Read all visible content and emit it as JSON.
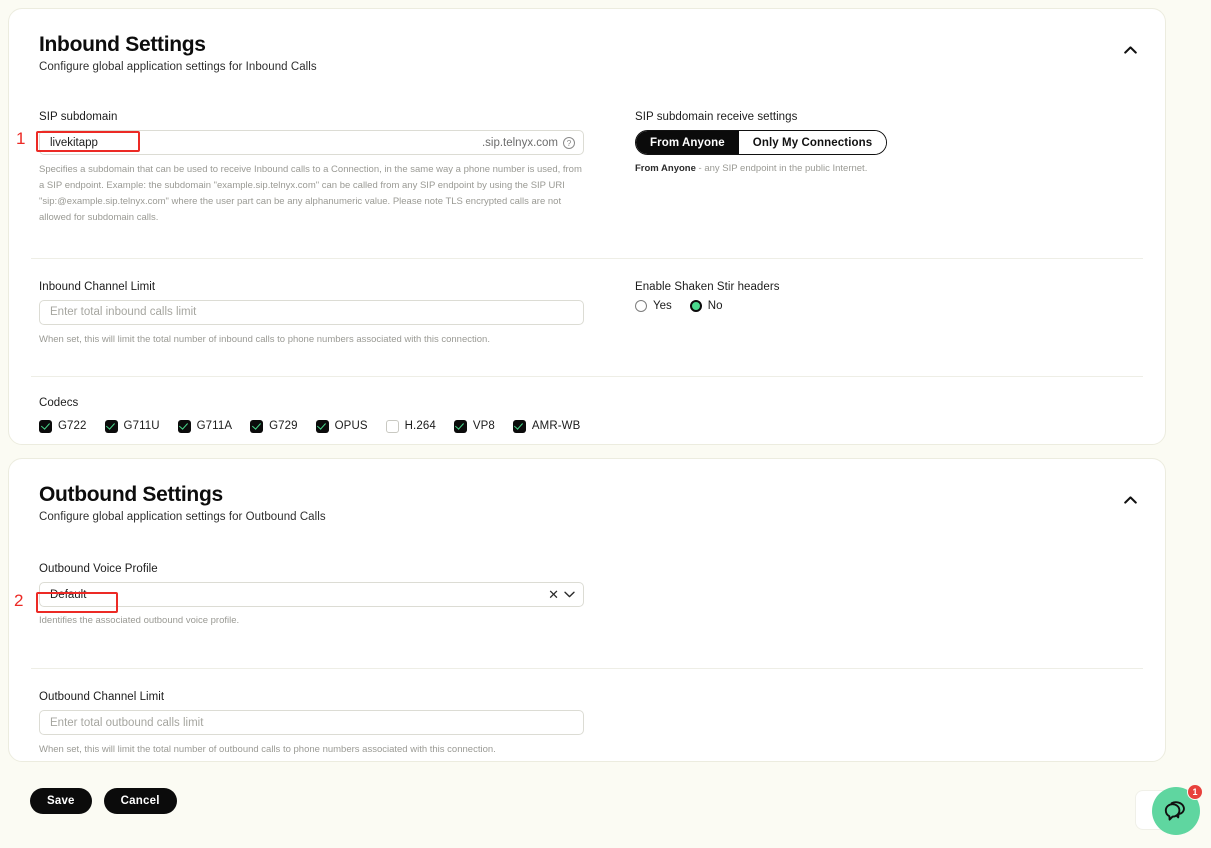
{
  "inbound": {
    "title": "Inbound Settings",
    "subtitle": "Configure global application settings for Inbound Calls",
    "collapse_icon": "chevron-up-icon",
    "sip_subdomain": {
      "label": "SIP subdomain",
      "value": "livekitapp",
      "suffix": ".sip.telnyx.com",
      "help_icon": "question-mark-circle-icon",
      "hint": "Specifies a subdomain that can be used to receive Inbound calls to a Connection, in the same way a phone number is used, from a SIP endpoint. Example: the subdomain \"example.sip.telnyx.com\" can be called from any SIP endpoint by using the SIP URI \"sip:@example.sip.telnyx.com\" where the user part can be any alphanumeric value. Please note TLS encrypted calls are not allowed for subdomain calls."
    },
    "receive_settings": {
      "label": "SIP subdomain receive settings",
      "options": [
        {
          "label": "From Anyone",
          "selected": true
        },
        {
          "label": "Only My Connections",
          "selected": false
        }
      ],
      "hint_strong": "From Anyone",
      "hint_rest": " - any SIP endpoint in the public Internet."
    },
    "channel_limit": {
      "label": "Inbound Channel Limit",
      "value": "",
      "placeholder": "Enter total inbound calls limit",
      "hint": "When set, this will limit the total number of inbound calls to phone numbers associated with this connection."
    },
    "shaken_stir": {
      "label": "Enable Shaken Stir headers",
      "options": [
        {
          "label": "Yes",
          "selected": false
        },
        {
          "label": "No",
          "selected": true
        }
      ]
    },
    "codecs": {
      "label": "Codecs",
      "items": [
        {
          "label": "G722",
          "checked": true
        },
        {
          "label": "G711U",
          "checked": true
        },
        {
          "label": "G711A",
          "checked": true
        },
        {
          "label": "G729",
          "checked": true
        },
        {
          "label": "OPUS",
          "checked": true
        },
        {
          "label": "H.264",
          "checked": false
        },
        {
          "label": "VP8",
          "checked": true
        },
        {
          "label": "AMR-WB",
          "checked": true
        }
      ]
    }
  },
  "outbound": {
    "title": "Outbound Settings",
    "subtitle": "Configure global application settings for Outbound Calls",
    "collapse_icon": "chevron-up-icon",
    "voice_profile": {
      "label": "Outbound Voice Profile",
      "value": "Default",
      "clear_icon": "close-x-icon",
      "chevron_icon": "chevron-down-icon",
      "hint": "Identifies the associated outbound voice profile."
    },
    "channel_limit": {
      "label": "Outbound Channel Limit",
      "value": "",
      "placeholder": "Enter total outbound calls limit",
      "hint": "When set, this will limit the total number of outbound calls to phone numbers associated with this connection."
    }
  },
  "footer": {
    "save_label": "Save",
    "cancel_label": "Cancel"
  },
  "chat_widget": {
    "icon": "chat-bubbles-icon",
    "badge_count": "1"
  },
  "annotations": [
    {
      "number": "1"
    },
    {
      "number": "2"
    }
  ],
  "colors": {
    "page_background": "#fbfbf3",
    "card_background": "#ffffff",
    "accent_dark": "#0b0b0b",
    "accent_green": "#4ad98d",
    "chat_green": "#5fd6a0",
    "badge_red": "#e8413c",
    "annotation_red": "#ec2a25"
  }
}
